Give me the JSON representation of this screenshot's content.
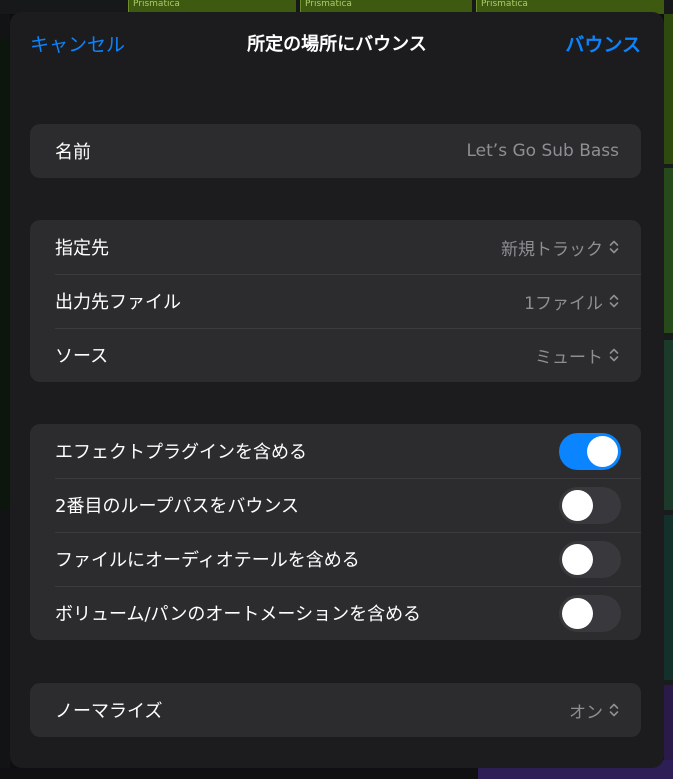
{
  "background": {
    "tracks": [
      "Prismatica",
      "Prismatica",
      "Prismatica"
    ]
  },
  "nav": {
    "cancel": "キャンセル",
    "title": "所定の場所にバウンス",
    "bounce": "バウンス"
  },
  "name_row": {
    "label": "名前",
    "value": "Let’s Go Sub Bass"
  },
  "selectors": [
    {
      "label": "指定先",
      "value": "新規トラック"
    },
    {
      "label": "出力先ファイル",
      "value": "1ファイル"
    },
    {
      "label": "ソース",
      "value": "ミュート"
    }
  ],
  "toggles": [
    {
      "label": "エフェクトプラグインを含める",
      "on": true
    },
    {
      "label": "2番目のループパスをバウンス",
      "on": false
    },
    {
      "label": "ファイルにオーディオテールを含める",
      "on": false
    },
    {
      "label": "ボリューム/パンのオートメーションを含める",
      "on": false
    }
  ],
  "normalize": {
    "label": "ノーマライズ",
    "value": "オン"
  },
  "colors": {
    "accent": "#0a84ff",
    "sheet": "#1c1c1e",
    "group": "#2c2c2e"
  },
  "icons": {
    "chevron": "chevron-up-down-icon"
  }
}
